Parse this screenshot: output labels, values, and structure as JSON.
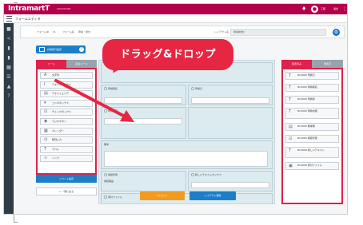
{
  "margin_glyphs": [
    "・",
    "並",
    "、"
  ],
  "topbar": {
    "brand_main": "Intramart",
    "brand_tail": "T",
    "date": "2015/01/08",
    "user_name": "工藤",
    "logout": "退出",
    "colors": {
      "bar": "#b3004a"
    }
  },
  "subbar": {
    "title": "フォームエディタ"
  },
  "leftnav": {
    "icons": [
      "home-icon",
      "share-icon",
      "doc-icon",
      "doc2-icon",
      "grid-icon",
      "list-icon",
      "chart-icon",
      "help-icon"
    ]
  },
  "metabar": {
    "form_id_label": "フォームID",
    "form_id_value": "11",
    "form_name_label": "フォーム名",
    "form_name_value": "申請・受付",
    "layout_label": "レイアウト名",
    "layout_value": "申請新規3"
  },
  "js_button": {
    "label": "共通実行設定",
    "badge": "?"
  },
  "palette": {
    "tabs": [
      "ツール",
      "読込ツール"
    ],
    "items": [
      {
        "icon": "text-icon",
        "glyph": "A",
        "label": "文字列"
      },
      {
        "icon": "textbox-icon",
        "glyph": "I",
        "label": "テキストボックス"
      },
      {
        "icon": "textarea-icon",
        "glyph": "▤",
        "label": "テキストエリア"
      },
      {
        "icon": "combobox-icon",
        "glyph": "▾",
        "label": "コンボボックス"
      },
      {
        "icon": "checkbox-icon",
        "glyph": "☑",
        "label": "チェックボックス"
      },
      {
        "icon": "radio-icon",
        "glyph": "◉",
        "label": "ラジオボタン"
      },
      {
        "icon": "calendar-icon",
        "glyph": "▦",
        "label": "カレンダー"
      },
      {
        "icon": "clock-icon",
        "glyph": "◷",
        "label": "時刻入力"
      },
      {
        "icon": "label-icon",
        "glyph": "T",
        "label": "ラベル"
      },
      {
        "icon": "link-icon",
        "glyph": "∞",
        "label": "リンク"
      }
    ],
    "event_button": "イベント設定",
    "back_button": "← 一覧に戻る"
  },
  "canvas": {
    "cells": [
      {
        "label": "申請者名",
        "num": "T"
      },
      {
        "label": "申請日",
        "num": "T"
      },
      {
        "label": "申請内容",
        "num": "T"
      },
      {
        "label": "備考",
        "num": "T"
      },
      {
        "label": "承認状態",
        "num": "T"
      },
      {
        "label": "新しいテキストボックス",
        "num": "T"
      },
      {
        "label": "添付ファイル",
        "num": "T"
      },
      {
        "label": "承認理由",
        "num": ""
      }
    ]
  },
  "props": {
    "tabs": [
      "配置済み",
      "非表示"
    ],
    "items": [
      {
        "glyph": "T",
        "label": "ID:0000 申請日"
      },
      {
        "glyph": "T",
        "label": "ID:0000 申請者名"
      },
      {
        "glyph": "T",
        "label": "ID:0000 申請者"
      },
      {
        "glyph": "T",
        "label": "ID:0000 申請内容"
      },
      {
        "glyph": "▤",
        "label": "ID:0000 備考欄"
      },
      {
        "glyph": "☑",
        "label": "ID:0000 承認状態"
      },
      {
        "glyph": "T",
        "label": "ID:0000 新しいテキスト"
      },
      {
        "glyph": "▣",
        "label": "ID:0000 添付ファイル"
      }
    ]
  },
  "bottom": {
    "preview": "プレビュー",
    "layout_update": "レイアウト更新",
    "colors": {
      "preview": "#f29a1f",
      "update": "#1c7ec9"
    }
  },
  "callout": {
    "text": "ドラッグ&ドロップ",
    "color": "#e62642"
  }
}
